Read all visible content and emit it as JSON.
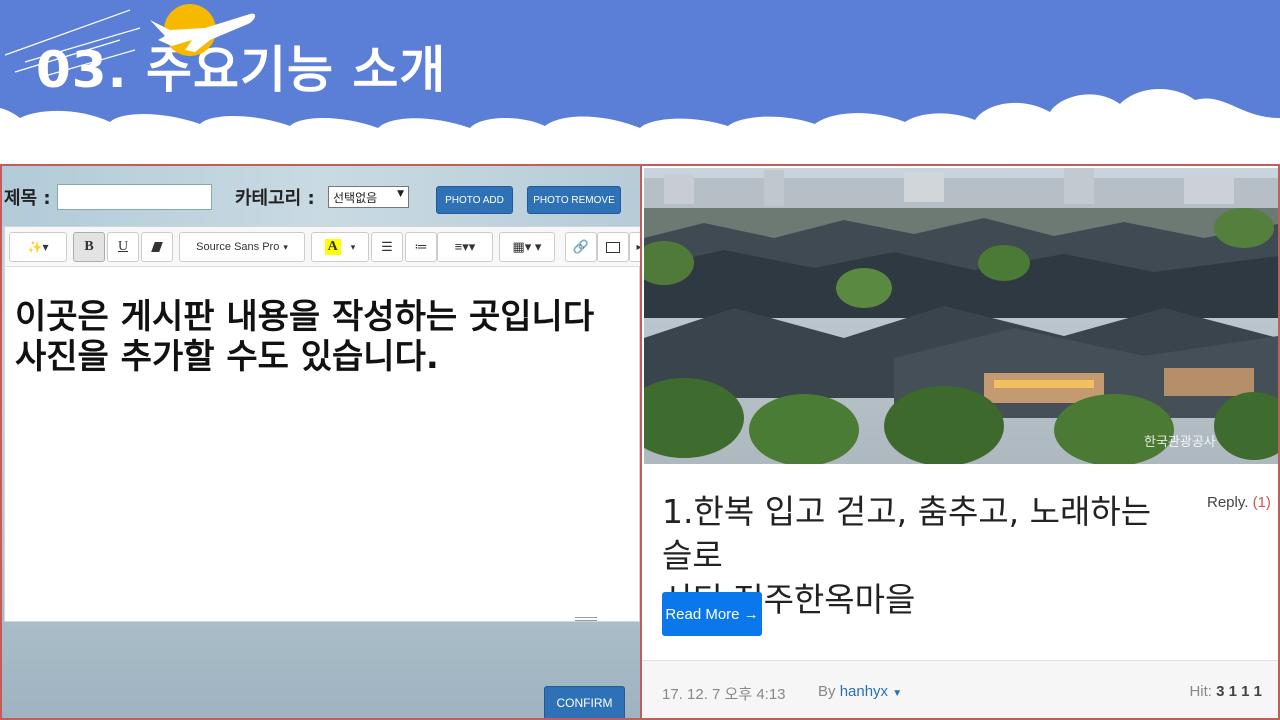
{
  "header": {
    "title": "03. 주요기능 소개"
  },
  "editor_form": {
    "title_label": "제목 :",
    "title_value": "",
    "category_label": "카테고리 :",
    "category_selected": "선택없음",
    "photo_add_label": "PHOTO ADD",
    "photo_remove_label": "PHOTO REMOVE",
    "confirm_label": "CONFIRM"
  },
  "toolbar": {
    "bold": "B",
    "underline": "U",
    "font_name": "Source Sans Pro",
    "text_color": "A"
  },
  "editor_content": {
    "line1": "이곳은 게시판 내용을 작성하는 곳입니다",
    "line2": "사진을 추가할 수도 있습니다."
  },
  "post": {
    "title_line1": "1.한복 입고 걷고, 춤추고, 노래하는 슬로",
    "title_line2": "시티 전주한옥마을",
    "reply_label": "Reply.",
    "reply_count": "(1)",
    "read_more_label": "Read More →",
    "photo_watermark": "한국관광공사",
    "date": "17. 12. 7 오후 4:13",
    "by_label": "By",
    "author": "hanhyx",
    "hit_label": "Hit:",
    "hit_value": "3 1 1 1"
  },
  "colors": {
    "banner_blue": "#5b7fd6",
    "panel_border": "#c85a5a",
    "button_blue": "#2f71b6",
    "read_more_blue": "#0a78ea",
    "reply_red": "#d9534f"
  }
}
